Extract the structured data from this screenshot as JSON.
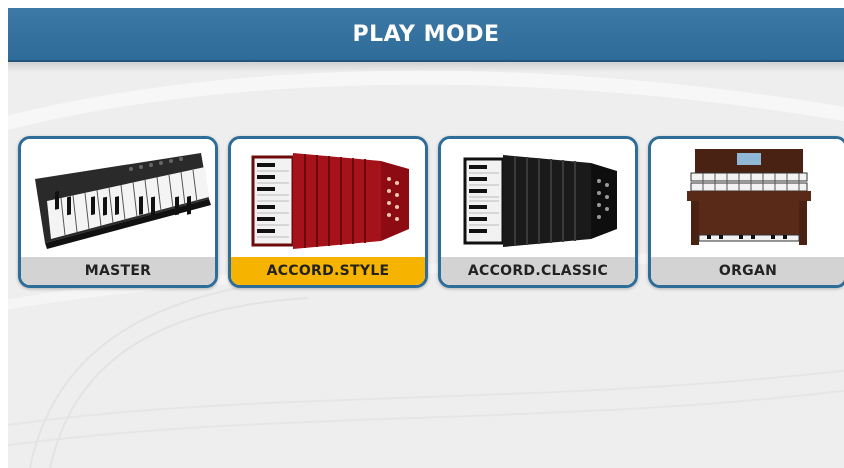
{
  "header": {
    "title": "PLAY MODE"
  },
  "modes": [
    {
      "label": "MASTER",
      "icon": "keyboard-icon",
      "selected": false
    },
    {
      "label": "ACCORD.STYLE",
      "icon": "red-accordion-icon",
      "selected": true
    },
    {
      "label": "ACCORD.CLASSIC",
      "icon": "black-accordion-icon",
      "selected": false
    },
    {
      "label": "ORGAN",
      "icon": "organ-icon",
      "selected": false
    }
  ],
  "colors": {
    "header": "#3471a0",
    "card_border": "#2d6d97",
    "label_bg": "#d3d3d3",
    "selected_label_bg": "#f6b400"
  }
}
